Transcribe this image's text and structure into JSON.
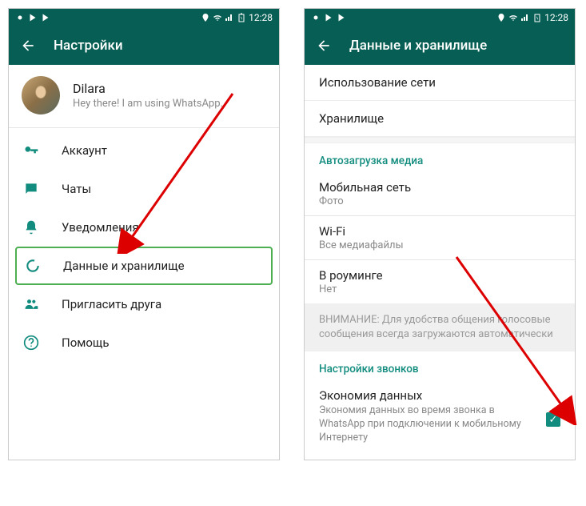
{
  "status": {
    "time": "12:28"
  },
  "left": {
    "toolbar_title": "Настройки",
    "profile": {
      "name": "Dilara",
      "status": "Hey there! I am using WhatsApp."
    },
    "menu": {
      "account": "Аккаунт",
      "chats": "Чаты",
      "notifications": "Уведомления",
      "data": "Данные и хранилище",
      "invite": "Пригласить друга",
      "help": "Помощь"
    }
  },
  "right": {
    "toolbar_title": "Данные и хранилище",
    "network_usage": "Использование сети",
    "storage": "Хранилище",
    "media_autodownload": {
      "header": "Автозагрузка медиа",
      "mobile": {
        "title": "Мобильная сеть",
        "value": "Фото"
      },
      "wifi": {
        "title": "Wi-Fi",
        "value": "Все медиафайлы"
      },
      "roaming": {
        "title": "В роуминге",
        "value": "Нет"
      }
    },
    "info_notice": "ВНИМАНИЕ: Для удобства общения голосовые сообщения всегда загружаются автоматически",
    "call_settings": {
      "header": "Настройки звонков",
      "low_data": {
        "title": "Экономия данных",
        "desc": "Экономия данных во время звонка в WhatsApp при подключении к мобильному Интернету"
      }
    }
  }
}
